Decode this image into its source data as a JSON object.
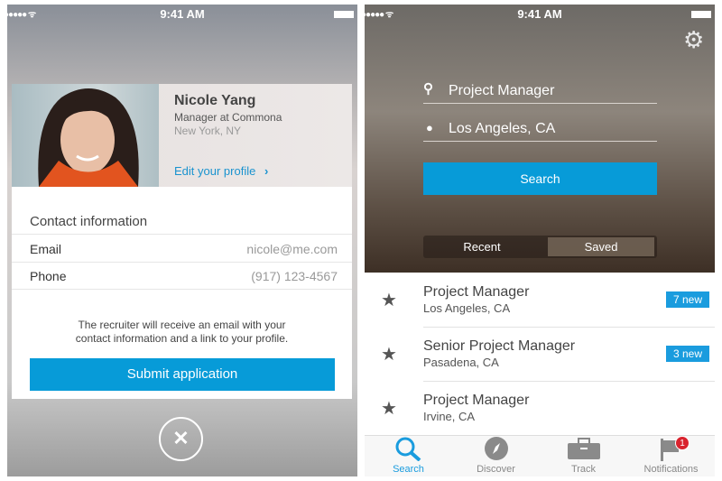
{
  "status_bar": {
    "time": "9:41 AM"
  },
  "apply": {
    "profile": {
      "name": "Nicole Yang",
      "title": "Manager at Commona",
      "location": "New York, NY",
      "edit_link": "Edit your profile"
    },
    "contact_heading": "Contact information",
    "rows": [
      {
        "label": "Email",
        "value": "nicole@me.com"
      },
      {
        "label": "Phone",
        "value": "(917) 123-4567"
      }
    ],
    "notice_line1": "The recruiter will receive an email with your",
    "notice_line2": "contact information and a link to your profile.",
    "submit_label": "Submit application"
  },
  "search": {
    "keyword_value": "Project Manager",
    "location_value": "Los Angeles, CA",
    "search_label": "Search",
    "segments": [
      "Recent",
      "Saved"
    ],
    "selected_segment": "Saved",
    "saved": [
      {
        "title": "Project Manager",
        "location": "Los Angeles, CA",
        "badge": "7 new"
      },
      {
        "title": "Senior Project Manager",
        "location": "Pasadena, CA",
        "badge": "3 new"
      },
      {
        "title": "Project Manager",
        "location": "Irvine, CA",
        "badge": ""
      }
    ]
  },
  "tabbar": {
    "tabs": [
      {
        "label": "Search",
        "icon": "search-icon"
      },
      {
        "label": "Discover",
        "icon": "compass-icon"
      },
      {
        "label": "Track",
        "icon": "briefcase-icon"
      },
      {
        "label": "Notifications",
        "icon": "flag-icon"
      }
    ],
    "active": "Search",
    "notification_count": "1"
  },
  "colors": {
    "accent": "#079bd8",
    "badge_red": "#d9232e"
  }
}
